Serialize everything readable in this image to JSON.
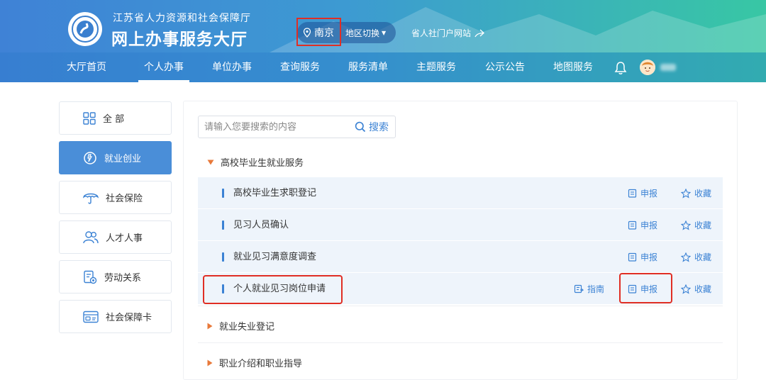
{
  "header": {
    "org_name": "江苏省人力资源和社会保障厅",
    "hall_title": "网上办事服务大厅",
    "city": "南京",
    "region_switch": "地区切换",
    "portal_link": "省人社门户网站"
  },
  "nav": [
    {
      "label": "大厅首页"
    },
    {
      "label": "个人办事"
    },
    {
      "label": "单位办事"
    },
    {
      "label": "查询服务"
    },
    {
      "label": "服务清单"
    },
    {
      "label": "主题服务"
    },
    {
      "label": "公示公告"
    },
    {
      "label": "地图服务"
    }
  ],
  "sidebar": [
    {
      "label": "全 部"
    },
    {
      "label": "就业创业"
    },
    {
      "label": "社会保险"
    },
    {
      "label": "人才人事"
    },
    {
      "label": "劳动关系"
    },
    {
      "label": "社会保障卡"
    }
  ],
  "search": {
    "placeholder": "请输入您要搜索的内容",
    "button": "搜索"
  },
  "categories": [
    {
      "label": "高校毕业生就业服务"
    },
    {
      "label": "就业失业登记"
    },
    {
      "label": "职业介绍和职业指导"
    }
  ],
  "services": [
    {
      "name": "高校毕业生求职登记"
    },
    {
      "name": "见习人员确认"
    },
    {
      "name": "就业见习满意度调查"
    },
    {
      "name": "个人就业见习岗位申请"
    }
  ],
  "actions": {
    "guide": "指南",
    "apply": "申报",
    "favorite": "收藏"
  },
  "colors": {
    "accent": "#3b82d4",
    "highlight": "#e02e24",
    "arrow": "#e8793a"
  }
}
